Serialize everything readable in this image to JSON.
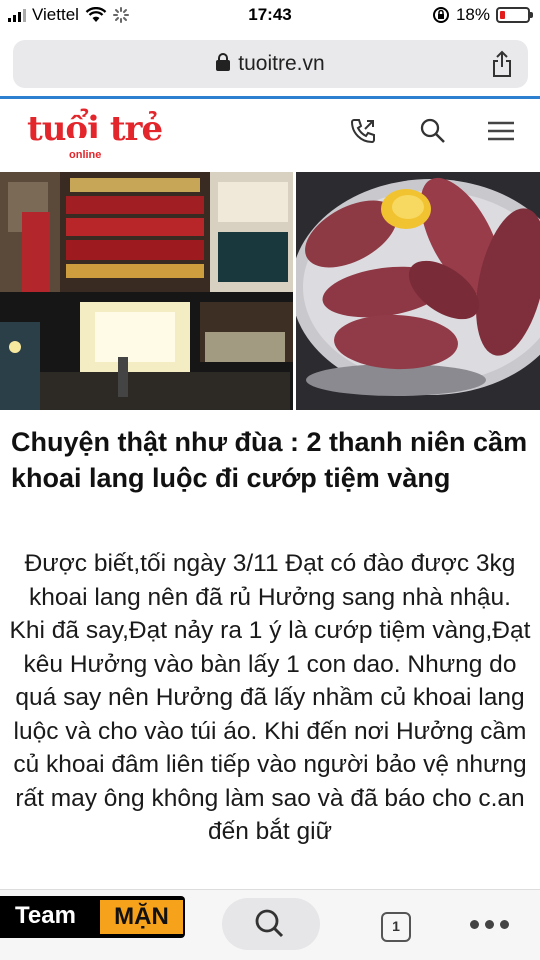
{
  "status_bar": {
    "carrier": "Viettel",
    "time": "17:43",
    "battery": "18%"
  },
  "browser": {
    "url": "tuoitre.vn"
  },
  "site": {
    "logo_main": "tuổi trẻ",
    "logo_sub": "online"
  },
  "article": {
    "headline": "Chuyện thật như đùa : 2 thanh niên cầm khoai lang luộc đi cướp tiệm vàng",
    "body": "Được biết,tối ngày 3/11 Đạt có đào được 3kg khoai lang nên đã rủ Hưởng sang nhà nhậu. Khi đã say,Đạt nảy ra 1 ý là cướp tiệm vàng,Đạt kêu Hưởng vào bàn lấy 1 con dao. Nhưng do quá say nên Hưởng đã lấy nhầm củ khoai lang luộc và cho vào túi áo. Khi đến nơi Hưởng cầm củ khoai đâm liên tiếp vào người bảo vệ nhưng rất may ông không làm sao và đã báo cho c.an đến bắt giữ"
  },
  "toolbar": {
    "team_label": "Team",
    "team_badge": "MẶN",
    "tab_count": "1"
  },
  "colors": {
    "brand_red": "#e3262c",
    "accent_blue": "#2d7fd0",
    "badge_orange": "#f7a21b"
  },
  "icons": [
    "wifi-icon",
    "lock-icon",
    "share-icon",
    "phone-icon",
    "search-icon",
    "menu-icon",
    "tabs-icon",
    "more-icon"
  ]
}
